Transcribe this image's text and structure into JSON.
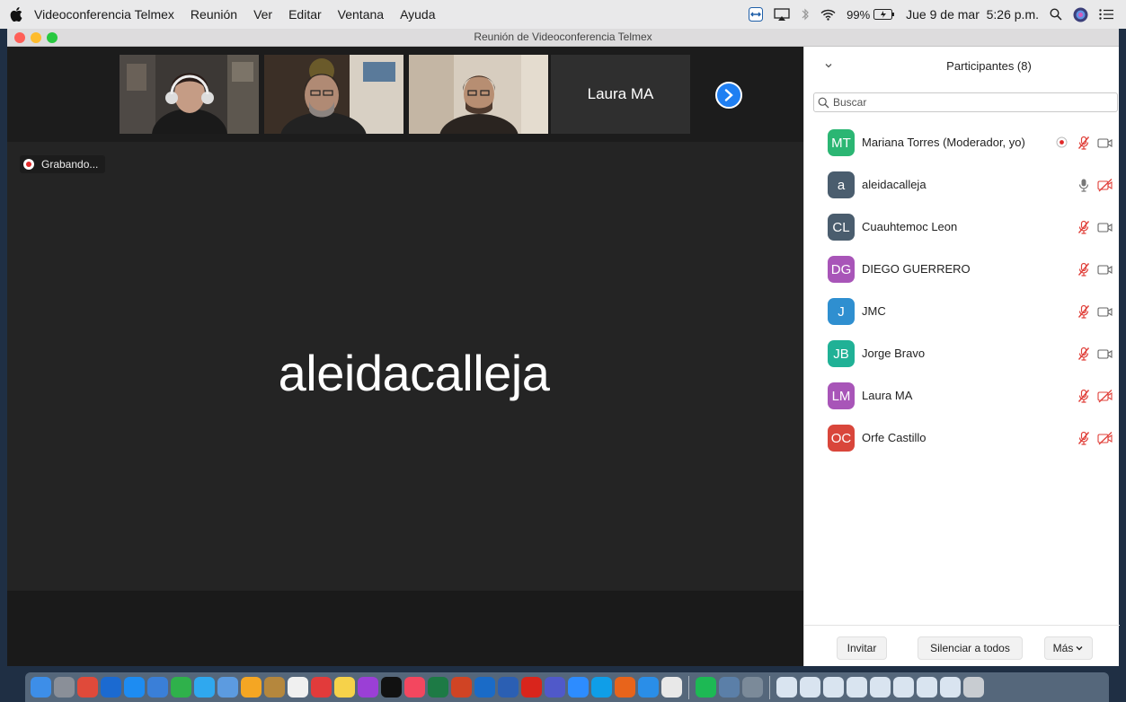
{
  "menubar": {
    "app_name": "Videoconferencia Telmex",
    "items": [
      "Reunión",
      "Ver",
      "Editar",
      "Ventana",
      "Ayuda"
    ],
    "battery": "99%",
    "datetime": "Jue 9 de mar  5:26 p.m."
  },
  "window": {
    "title": "Reunión de Videoconferencia Telmex"
  },
  "thumbnails": [
    {
      "type": "video",
      "person": "woman with headphones"
    },
    {
      "type": "video",
      "person": "man with beard"
    },
    {
      "type": "video",
      "person": "man with glasses"
    },
    {
      "type": "name",
      "label": "Laura MA"
    }
  ],
  "recording": {
    "label": "Grabando..."
  },
  "active_speaker": {
    "name": "aleidacalleja"
  },
  "participants_panel": {
    "title": "Participantes (8)",
    "search_placeholder": "Buscar",
    "participants": [
      {
        "initials": "MT",
        "name": "Mariana Torres (Moderador, yo)",
        "color": "#2bb673",
        "recording": true,
        "mic": "muted",
        "video": "on"
      },
      {
        "initials": "a",
        "name": "aleidacalleja",
        "color": "#4a5d6e",
        "recording": false,
        "mic": "on",
        "video": "off"
      },
      {
        "initials": "CL",
        "name": "Cuauhtemoc Leon",
        "color": "#4a5d6e",
        "recording": false,
        "mic": "muted",
        "video": "on"
      },
      {
        "initials": "DG",
        "name": "DIEGO GUERRERO",
        "color": "#a855b8",
        "recording": false,
        "mic": "muted",
        "video": "on"
      },
      {
        "initials": "J",
        "name": "JMC",
        "color": "#2f8fd0",
        "recording": false,
        "mic": "muted",
        "video": "on"
      },
      {
        "initials": "JB",
        "name": "Jorge Bravo",
        "color": "#20b196",
        "recording": false,
        "mic": "muted",
        "video": "on"
      },
      {
        "initials": "LM",
        "name": "Laura MA",
        "color": "#a855b8",
        "recording": false,
        "mic": "muted",
        "video": "off"
      },
      {
        "initials": "OC",
        "name": "Orfe Castillo",
        "color": "#d9463b",
        "recording": false,
        "mic": "muted",
        "video": "off"
      }
    ],
    "footer": {
      "invite": "Invitar",
      "mute_all": "Silenciar a todos",
      "more": "Más"
    }
  },
  "colors": {
    "muted_red": "#e0403a",
    "accent_blue": "#1f7ff2",
    "record_red": "#e02828"
  }
}
